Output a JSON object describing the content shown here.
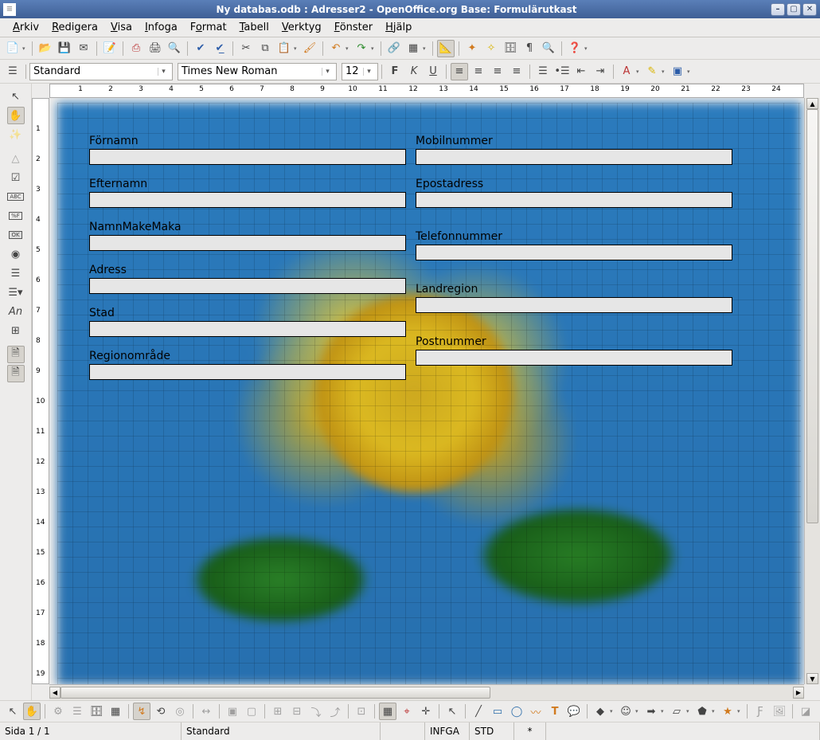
{
  "window": {
    "title": "Ny databas.odb : Adresser2 - OpenOffice.org Base: Formulärutkast"
  },
  "menubar": {
    "items": [
      {
        "label": "Arkiv",
        "ul": "A"
      },
      {
        "label": "Redigera",
        "ul": "R"
      },
      {
        "label": "Visa",
        "ul": "V"
      },
      {
        "label": "Infoga",
        "ul": "I"
      },
      {
        "label": "Format",
        "ul": "o"
      },
      {
        "label": "Tabell",
        "ul": "T"
      },
      {
        "label": "Verktyg",
        "ul": "V"
      },
      {
        "label": "Fönster",
        "ul": "F"
      },
      {
        "label": "Hjälp",
        "ul": "H"
      }
    ]
  },
  "format_bar": {
    "style": "Standard",
    "font": "Times New Roman",
    "size": "12"
  },
  "ruler": {
    "h_numbers": [
      1,
      2,
      3,
      4,
      5,
      6,
      7,
      8,
      9,
      10,
      11,
      12,
      13,
      14,
      15,
      16,
      17,
      18,
      19,
      20,
      21,
      22,
      23,
      24
    ],
    "v_numbers": [
      1,
      2,
      3,
      4,
      5,
      6,
      7,
      8,
      9,
      10,
      11,
      12,
      13,
      14,
      15,
      16,
      17,
      18,
      19
    ]
  },
  "form": {
    "left": [
      {
        "label": "Förnamn"
      },
      {
        "label": "Efternamn"
      },
      {
        "label": "NamnMakeMaka"
      },
      {
        "label": "Adress"
      },
      {
        "label": "Stad"
      },
      {
        "label": "Regionområde"
      }
    ],
    "right": [
      {
        "label": "Mobilnummer"
      },
      {
        "label": "Epostadress"
      },
      {
        "label": "Telefonnummer"
      },
      {
        "label": "Landregion"
      },
      {
        "label": "Postnummer"
      }
    ]
  },
  "statusbar": {
    "page": "Sida  1 / 1",
    "style": "Standard",
    "mode": "INFGA",
    "sel": "STD",
    "mod": "*"
  }
}
